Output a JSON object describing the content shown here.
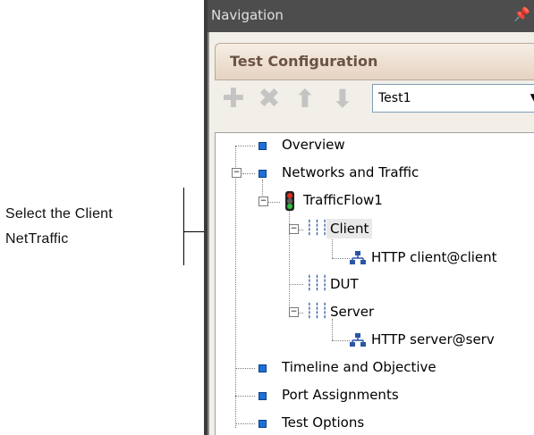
{
  "annotation": {
    "line1": "Select the Client",
    "line2": "NetTraffic"
  },
  "panel": {
    "title": "Navigation",
    "pin_icon": "pin-icon",
    "header": "Test Configuration",
    "toolbar": {
      "add_icon": "add-icon",
      "delete_icon": "delete-icon",
      "up_icon": "arrow-up-icon",
      "down_icon": "arrow-down-icon",
      "selected": "Test1"
    },
    "tree": {
      "overview": "Overview",
      "networks": "Networks and Traffic",
      "trafficflow": "TrafficFlow1",
      "client": "Client",
      "http_client": "HTTP client@client",
      "dut": "DUT",
      "server": "Server",
      "http_server": "HTTP server@serv",
      "timeline": "Timeline and Objective",
      "ports": "Port Assignments",
      "options": "Test Options"
    }
  },
  "colors": {
    "titlebar": "#4d4d4d",
    "header_text": "#6a5345",
    "node_square": "#1e6fd8",
    "net_icon": "#2a56a6"
  }
}
